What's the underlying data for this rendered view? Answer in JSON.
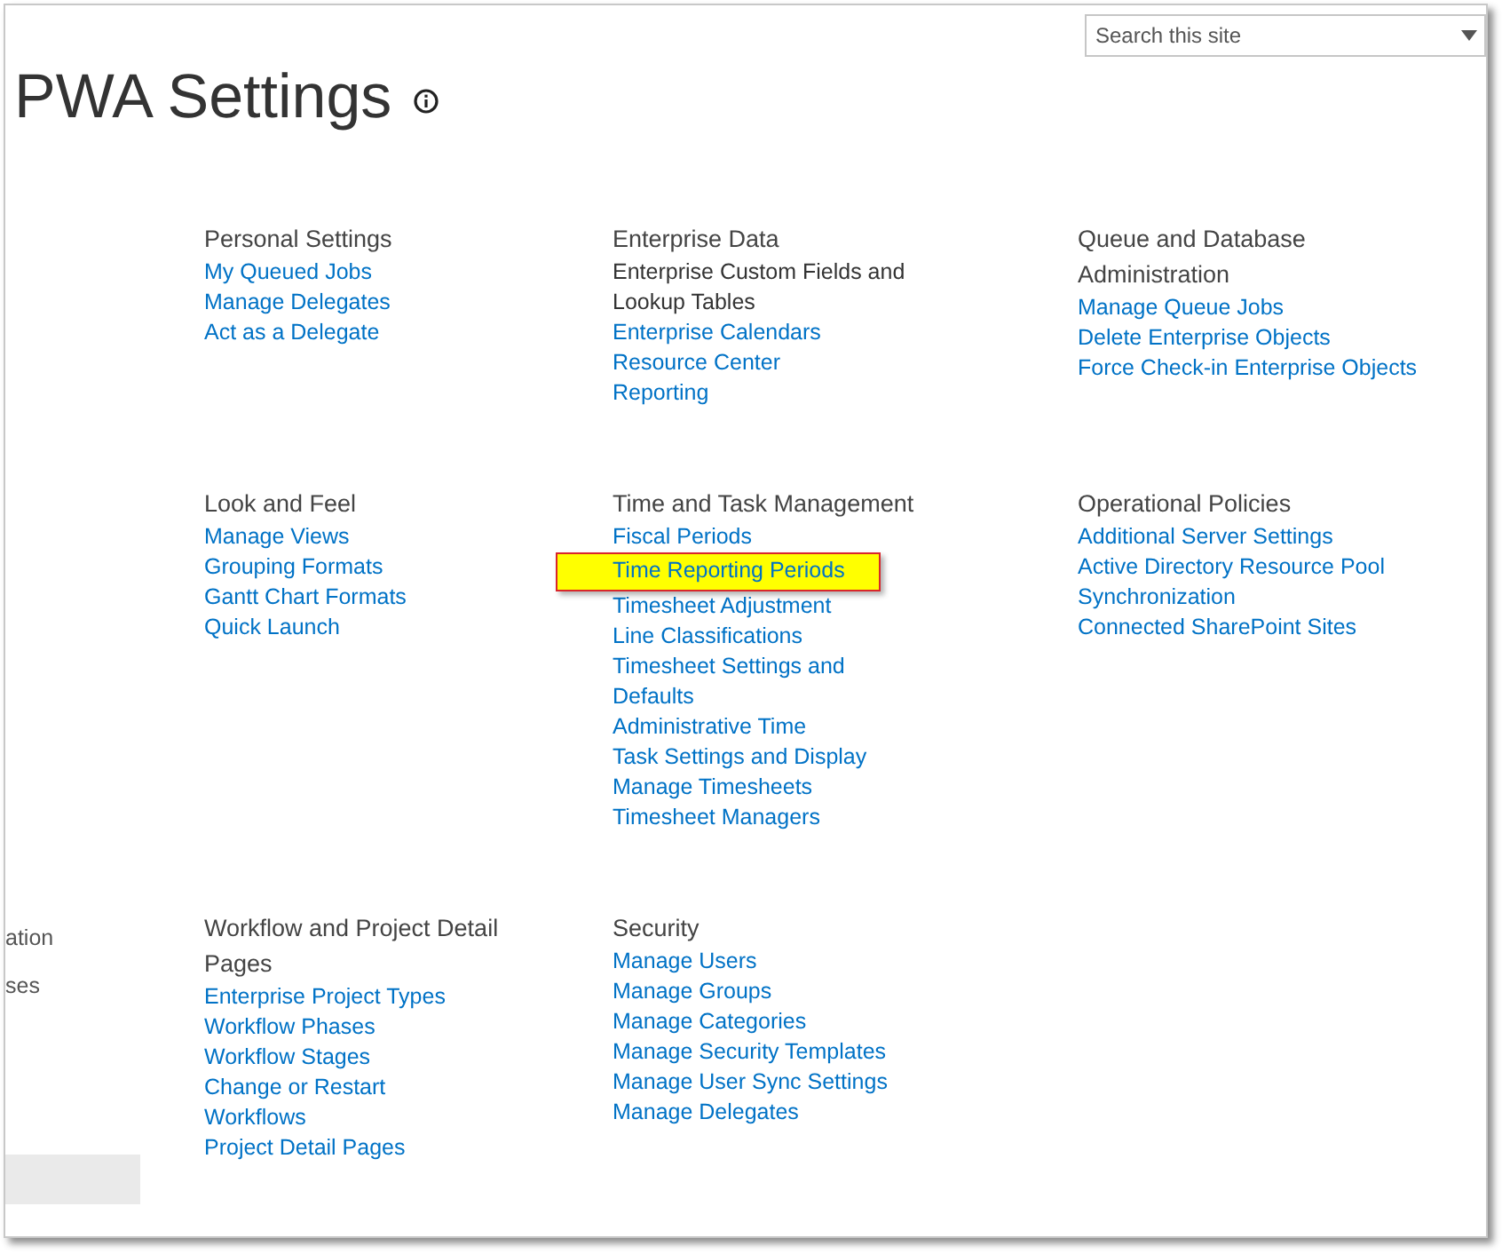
{
  "page": {
    "title": "PWA Settings"
  },
  "search": {
    "placeholder": "Search this site"
  },
  "left_nav": [
    {
      "label": "ation",
      "selected": false
    },
    {
      "label": "ses",
      "selected": false
    },
    {
      "selected": true
    }
  ],
  "sections": [
    {
      "title": "Personal Settings",
      "items": [
        {
          "label": "My Queued Jobs",
          "kind": "link",
          "highlighted": false
        },
        {
          "label": "Manage Delegates",
          "kind": "link",
          "highlighted": false
        },
        {
          "label": "Act as a Delegate",
          "kind": "link",
          "highlighted": false
        }
      ]
    },
    {
      "title": "Enterprise Data",
      "items": [
        {
          "label": "Enterprise Custom Fields and Lookup Tables",
          "kind": "text",
          "highlighted": false
        },
        {
          "label": "Enterprise Calendars",
          "kind": "link",
          "highlighted": false
        },
        {
          "label": "Resource Center",
          "kind": "link",
          "highlighted": false
        },
        {
          "label": "Reporting",
          "kind": "link",
          "highlighted": false
        }
      ]
    },
    {
      "title": "Queue and Database Administration",
      "items": [
        {
          "label": "Manage Queue Jobs",
          "kind": "link",
          "highlighted": false
        },
        {
          "label": "Delete Enterprise Objects",
          "kind": "link",
          "highlighted": false
        },
        {
          "label": "Force Check-in Enterprise Objects",
          "kind": "link",
          "highlighted": false
        }
      ]
    },
    {
      "title": "Look and Feel",
      "items": [
        {
          "label": "Manage Views",
          "kind": "link",
          "highlighted": false
        },
        {
          "label": "Grouping Formats",
          "kind": "link",
          "highlighted": false
        },
        {
          "label": "Gantt Chart Formats",
          "kind": "link",
          "highlighted": false
        },
        {
          "label": "Quick Launch",
          "kind": "link",
          "highlighted": false
        }
      ]
    },
    {
      "title": "Time and Task Management",
      "items": [
        {
          "label": "Fiscal Periods",
          "kind": "link",
          "highlighted": false
        },
        {
          "label": "Time Reporting Periods",
          "kind": "link",
          "highlighted": true
        },
        {
          "label": "Timesheet Adjustment",
          "kind": "link",
          "highlighted": false
        },
        {
          "label": "Line Classifications",
          "kind": "link",
          "highlighted": false
        },
        {
          "label": "Timesheet Settings and Defaults",
          "kind": "link",
          "highlighted": false
        },
        {
          "label": "Administrative Time",
          "kind": "link",
          "highlighted": false
        },
        {
          "label": "Task Settings and Display",
          "kind": "link",
          "highlighted": false
        },
        {
          "label": "Manage Timesheets",
          "kind": "link",
          "highlighted": false
        },
        {
          "label": "Timesheet Managers",
          "kind": "link",
          "highlighted": false
        }
      ]
    },
    {
      "title": "Operational Policies",
      "items": [
        {
          "label": "Additional Server Settings",
          "kind": "link",
          "highlighted": false
        },
        {
          "label": "Active Directory Resource Pool Synchronization",
          "kind": "link",
          "highlighted": false
        },
        {
          "label": "Connected SharePoint Sites",
          "kind": "link",
          "highlighted": false
        }
      ]
    },
    {
      "title": "Workflow and Project Detail Pages",
      "items": [
        {
          "label": "Enterprise Project Types",
          "kind": "link",
          "highlighted": false
        },
        {
          "label": "Workflow Phases",
          "kind": "link",
          "highlighted": false
        },
        {
          "label": "Workflow Stages",
          "kind": "link",
          "highlighted": false
        },
        {
          "label": "Change or Restart Workflows",
          "kind": "link",
          "highlighted": false
        },
        {
          "label": "Project Detail Pages",
          "kind": "link",
          "highlighted": false
        }
      ]
    },
    {
      "title": "Security",
      "items": [
        {
          "label": "Manage Users",
          "kind": "link",
          "highlighted": false
        },
        {
          "label": "Manage Groups",
          "kind": "link",
          "highlighted": false
        },
        {
          "label": "Manage Categories",
          "kind": "link",
          "highlighted": false
        },
        {
          "label": "Manage Security Templates",
          "kind": "link",
          "highlighted": false
        },
        {
          "label": "Manage User Sync Settings",
          "kind": "link",
          "highlighted": false
        },
        {
          "label": "Manage Delegates",
          "kind": "link",
          "highlighted": false
        }
      ]
    }
  ]
}
